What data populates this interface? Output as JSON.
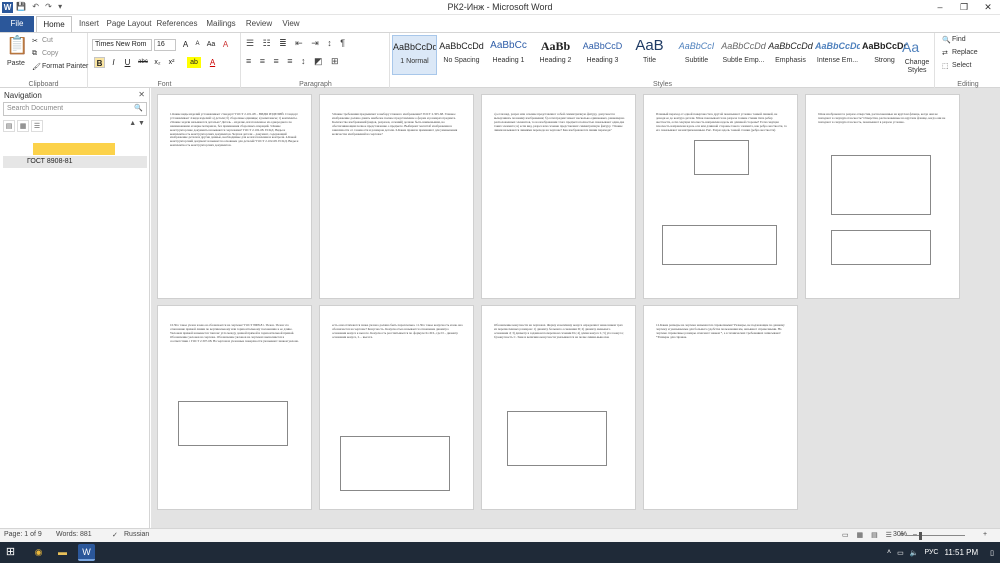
{
  "window": {
    "title": "РК2-Инж - Microsoft Word",
    "minimize": "–",
    "restore": "❐",
    "close": "✕"
  },
  "qat": {
    "save": "💾",
    "undo": "↶",
    "redo": "↷",
    "customize": "▾"
  },
  "tabs": [
    "File",
    "Home",
    "Insert",
    "Page Layout",
    "References",
    "Mailings",
    "Review",
    "View"
  ],
  "active_tab": "Home",
  "ribbon": {
    "clipboard": {
      "label": "Clipboard",
      "paste": "Paste",
      "cut": "Cut",
      "copy": "Copy",
      "format_painter": "Format Painter"
    },
    "font": {
      "label": "Font",
      "family": "Times New Rom",
      "size": "16",
      "bold": "B",
      "italic": "I",
      "underline": "U",
      "strike": "abc",
      "sub": "x₂",
      "sup": "x²",
      "grow": "A",
      "shrink": "A",
      "aa": "Aa",
      "clear": "A",
      "highlight": "ab",
      "color": "A"
    },
    "paragraph": {
      "label": "Paragraph"
    },
    "styles": {
      "label": "Styles",
      "items": [
        {
          "sample": "AaBbCcDd",
          "name": "1 Normal"
        },
        {
          "sample": "AaBbCcDd",
          "name": "No Spacing"
        },
        {
          "sample": "AaBbCc",
          "name": "Heading 1"
        },
        {
          "sample": "AaBb",
          "name": "Heading 2"
        },
        {
          "sample": "AaBbCcD",
          "name": "Heading 3"
        },
        {
          "sample": "AaB",
          "name": "Title"
        },
        {
          "sample": "AaBbCcI",
          "name": "Subtitle"
        },
        {
          "sample": "AaBbCcDd",
          "name": "Subtle Emp..."
        },
        {
          "sample": "AaBbCcDd",
          "name": "Emphasis"
        },
        {
          "sample": "AaBbCcDd",
          "name": "Intense Em..."
        },
        {
          "sample": "AaBbCcDd",
          "name": "Strong"
        }
      ],
      "change_styles": "Change Styles"
    },
    "editing": {
      "label": "Editing",
      "find": "Find",
      "replace": "Replace",
      "select": "Select"
    }
  },
  "navigation": {
    "title": "Navigation",
    "close": "✕",
    "search_placeholder": "Search Document",
    "search_icon": "🔍",
    "highlight": "",
    "result": "ГОСТ 8908-81"
  },
  "pages": [
    {
      "id": "p1",
      "text": "1.Какие виды изделий устанавливает стандарт? ГОСТ 2.101-68 – ВИДЫ ИЗДЕЛИЙ. Стандарт устанавливает 4 вида изделий: а) детали; б) сборочные единицы; в) комплексы; г) комплекты. 2.Какие задачи называются деталью? Деталь – изделие, изготовленное из однородного по наименованию и марке материала, без применения сборочных операций. 3.Какие конструкторские документы называются чертежами? ГОСТ 2.102-68. ЕСКД. Виды и комплектность конструкторских документов. Чертеж детали – документ, содержащий изображение детали и другие данные, необходимые для ее изготовления и контроля. 4.Какой конструкторский документ называется основным для деталей? ГОСТ 2.102-68. ЕСКД. Виды и комплектность конструкторских документов."
    },
    {
      "id": "p2",
      "text": "5.Какие требования предъявляет к выбору главного изображения? ГОСТ 2.305-68. Главное изображение должно давать наиболее полное представление о форме и размерах предмета. Количество изображений (видов, разрезов, сечений) должно быть наименьшим, но обеспечивающим полное представление о предмете. Выбирают масштаб изображения в зависимости от сложности и размеров детали. 6.Какие правила применяют для уменьшения количества изображений на чертеже?"
    },
    {
      "id": "p3",
      "text": "а) если вид, разрез или сечение представляют собой симметричную фигуру, допускается вычерчивать половину изображения; б) если предмет имеет несколько одинаковых, равномерно расположенных элементов, то на изображении этого предмета полностью показывают один-два таких элемента; в) если вид, разрез или сечение представляют симметричную фигуру. 7.Какие линии называются линиями перехода на чертеже? Как изображаются линии перехода?"
    },
    {
      "id": "p4",
      "text": "Плавный переход от одной поверхности к другой показывают условно тонкой линией, не доводя ее до контура детали. 8.Как показывается на разрезе тонкие стенки типа ребер жесткости, если секущая плоскость направлена вдоль их длинной стороны? Если секущая плоскость направлена вдоль оси или длинной стороны такого элемента, как ребро жесткости, то его показывают незаштрихованным. Рис. Разрез вдоль тонкой стенки (ребра жесткости)"
    },
    {
      "id": "p5",
      "text": "9.Как изображают в разрезе отверстия, расположенные на круглом фланце, когда они не попадают в секущую плоскость? Отверстия, расположенные на круглом фланце, когда они не попадают в секущую плоскость, показывают в разрезе условно."
    },
    {
      "id": "p6",
      "text": "10.Что такое уклон и как он обозначается на чертеже? ГОСТ 8908-81. Уклон. Уклон это отношение прямой линии по вертикальному или горизонтальному положению к ее длине. Уклоном прямой называется тангенс угла между данной прямой и горизонтальной прямой. Обозначение уклонов на чертеже. Обозначение уклонов на чертежах выполняется в соответствии с ГОСТ 2.307-68. На чертежах уклонные поверхности указывают знаком уклона."
    },
    {
      "id": "p7",
      "text": "есть они отличаются знака уклона должна быть параллельна. 11.Что такое конусность и как она обозначается на чертеже? Конусность. Конусностью называется отношение диаметра основания конуса к высоте. Конусность рассчитывается по формуле K=D/L, где D – диаметр основания конуса, L – высота."
    },
    {
      "id": "p8",
      "text": "Обозначение конусности на чертежах. Форму и величину конуса определяют нанесением трех из перечисленных размеров: 1) диаметр большего основания D; 2) диаметр меньшего основания d; 3) диаметр в заданном поперечном сечении Ds; 4) длина конуса L; 5) угол конуса; 6) конусность C. Знак и величина конусности указываются на полке линии-выноски."
    },
    {
      "id": "p9",
      "text": "12.Какие размеры на чертеже называются справочными? Размеры, не подлежащие по данному чертежу и указываемые для большего удобства пользования им, называют справочными. На чертеже справочные размеры отмечают знаком *, а в технических требованиях записывают: *Размеры для справок."
    }
  ],
  "status": {
    "page": "Page: 1 of 9",
    "words": "Words: 881",
    "language": "Russian",
    "zoom": "30%",
    "zoom_minus": "–",
    "zoom_plus": "+"
  },
  "taskbar": {
    "start": "⊞",
    "time": "11:51 PM",
    "lang": "РУС",
    "tray_up": "˄",
    "volume": "🔈",
    "network": "▭"
  }
}
